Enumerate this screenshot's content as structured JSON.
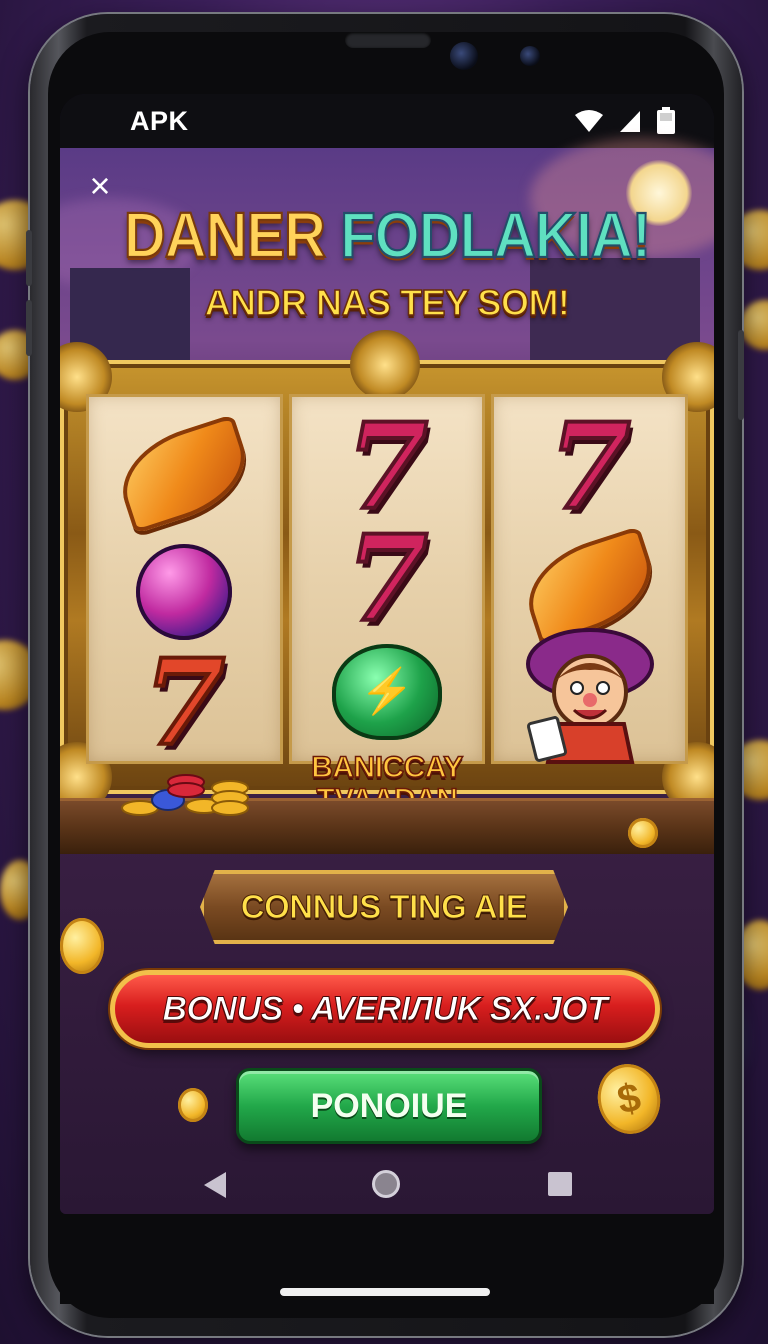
{
  "status_bar": {
    "carrier": "APK",
    "icons": [
      "wifi-icon",
      "signal-icon",
      "battery-icon"
    ]
  },
  "game": {
    "close_icon": "×",
    "title_part1": "DANER ",
    "title_part2": "FODLAKIA!",
    "subtitle": "ANDR NAS TEY SOM!",
    "reels": [
      {
        "symbols": [
          "leaf",
          "orb",
          "seven"
        ]
      },
      {
        "symbols": [
          "seven",
          "seven",
          "gem"
        ],
        "caption_line1": "BANICCAY",
        "caption_line2": "TVAADAN"
      },
      {
        "symbols": [
          "seven",
          "leaf",
          "mascot"
        ]
      }
    ],
    "wood_button_label": "CONNUS TING AIE",
    "bonus_banner_text": "BONUS • AVERIЛUK SX.JOT",
    "cta_label": "PONOIUE",
    "coin_symbol": "$"
  },
  "navbar": {
    "icons": [
      "back-icon",
      "home-icon",
      "recent-apps-icon"
    ]
  },
  "colors": {
    "accent_gold": "#ffd35a",
    "banner_red": "#d81e1e",
    "cta_green": "#22a84a",
    "background_purple": "#3b1f5a"
  }
}
